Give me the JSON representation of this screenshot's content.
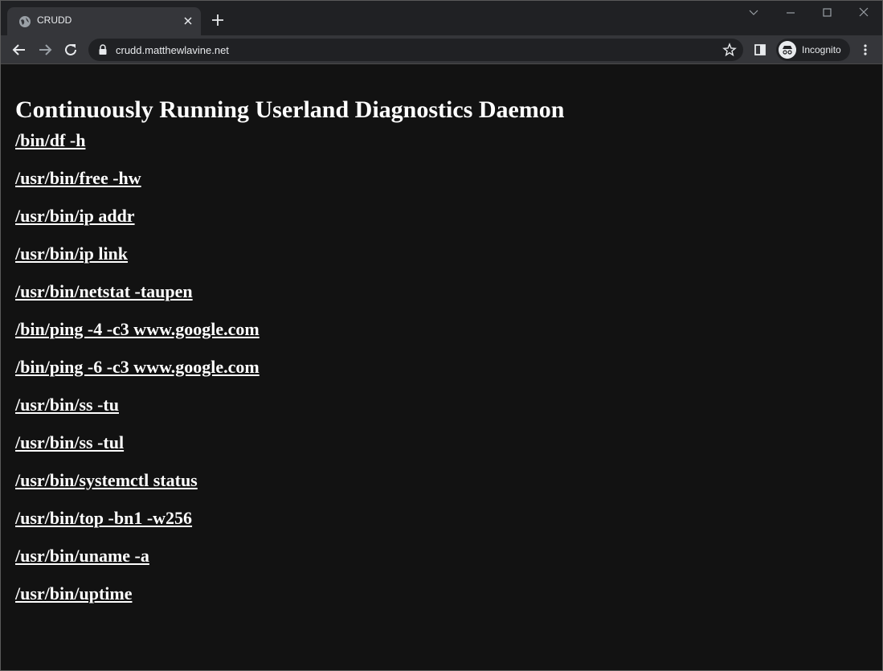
{
  "browser": {
    "tab_title": "CRUDD",
    "url": "crudd.matthewlavine.net",
    "incognito_label": "Incognito"
  },
  "icons": {
    "favicon": "globe-icon",
    "close": "close-icon",
    "new_tab": "plus-icon",
    "back": "arrow-left-icon",
    "forward": "arrow-right-icon",
    "reload": "reload-icon",
    "lock": "lock-icon",
    "bookmark": "star-icon",
    "side_panel": "side-panel-icon",
    "incognito": "incognito-icon",
    "menu": "kebab-menu-icon"
  },
  "page": {
    "heading": "Continuously Running Userland Diagnostics Daemon",
    "commands": [
      "/bin/df -h",
      "/usr/bin/free -hw",
      "/usr/bin/ip addr",
      "/usr/bin/ip link",
      "/usr/bin/netstat -taupen",
      "/bin/ping -4 -c3 www.google.com",
      "/bin/ping -6 -c3 www.google.com",
      "/usr/bin/ss -tu",
      "/usr/bin/ss -tul",
      "/usr/bin/systemctl status",
      "/usr/bin/top -bn1 -w256",
      "/usr/bin/uname -a",
      "/usr/bin/uptime"
    ]
  },
  "colors": {
    "page_background": "#121212",
    "text": "#ffffff",
    "chrome_frame": "#202124",
    "chrome_toolbar": "#35363a"
  }
}
